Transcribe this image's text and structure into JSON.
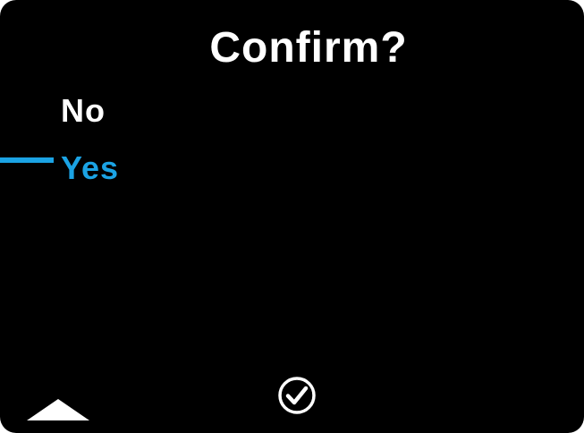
{
  "dialog": {
    "title": "Confirm?"
  },
  "menu": {
    "items": [
      {
        "label": "No",
        "selected": false
      },
      {
        "label": "Yes",
        "selected": true
      }
    ]
  },
  "softkeys": {
    "left_icon": "up-arrow-icon",
    "center_icon": "check-circle-icon"
  },
  "colors": {
    "background": "#000000",
    "text": "#ffffff",
    "accent": "#1ba3e4"
  }
}
